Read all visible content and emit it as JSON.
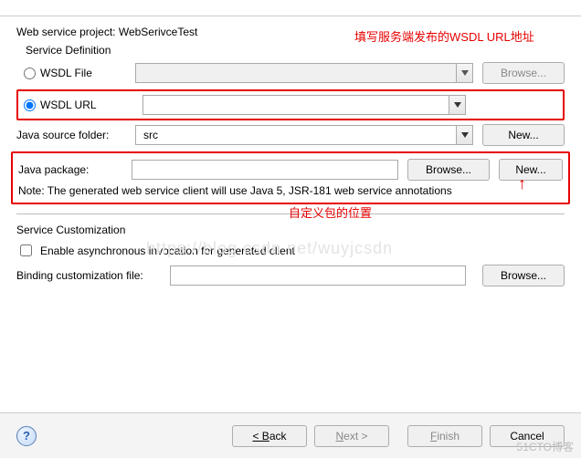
{
  "project": {
    "label": "Web service project:",
    "value": "WebSerivceTest"
  },
  "serviceDefinition": {
    "label": "Service Definition",
    "wsdlFile": {
      "label": "WSDL File"
    },
    "wsdlUrl": {
      "label": "WSDL URL"
    },
    "browseBtn": "Browse..."
  },
  "javaSource": {
    "label": "Java source folder:",
    "value": "src",
    "newBtn": "New..."
  },
  "javaPackage": {
    "label": "Java package:",
    "value": "",
    "browseBtn": "Browse...",
    "newBtn": "New..."
  },
  "note": "Note: The generated web service client will use Java 5, JSR-181 web service annotations",
  "customization": {
    "label": "Service Customization",
    "enableAsync": "Enable asynchronous invocation for generated client",
    "bindingLabel": "Binding customization file:",
    "bindingValue": "",
    "browseBtn": "Browse..."
  },
  "annotations": {
    "wsdlUrlHint": "填写服务端发布的WSDL URL地址",
    "packageHint": "自定义包的位置",
    "arrow": "↑"
  },
  "footer": {
    "back": "< Back",
    "next": "Next >",
    "finish": "Finish",
    "cancel": "Cancel"
  },
  "watermark": {
    "corner": "51CTO博客",
    "bg": "https://blog.csdn.net/wuyjcsdn"
  }
}
